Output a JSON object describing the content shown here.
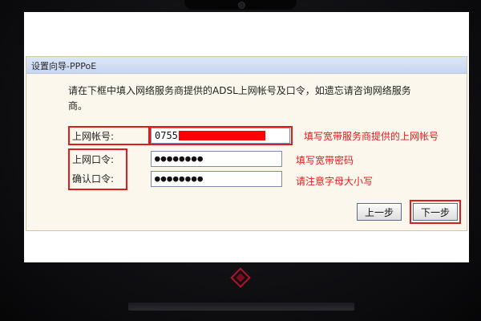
{
  "window": {
    "title": "设置向导-PPPoE"
  },
  "instruction": "请在下框中填入网络服务商提供的ADSL上网帐号及口令，如遗忘请咨询网络服务商。",
  "fields": {
    "account": {
      "label": "上网帐号:",
      "value": "0755"
    },
    "password": {
      "label": "上网口令:",
      "value": "●●●●●●●●"
    },
    "confirm": {
      "label": "确认口令:",
      "value": "●●●●●●●●"
    }
  },
  "notes": {
    "account": "填写宽带服务商提供的上网帐号",
    "password": "填写宽带密码",
    "confirm": "请注意字母大小写"
  },
  "buttons": {
    "prev": "上一步",
    "next": "下一步"
  },
  "colors": {
    "annotation": "#e11b1b",
    "titlebar": "#c7d6f1",
    "dialog_bg": "#fbf7ec"
  }
}
